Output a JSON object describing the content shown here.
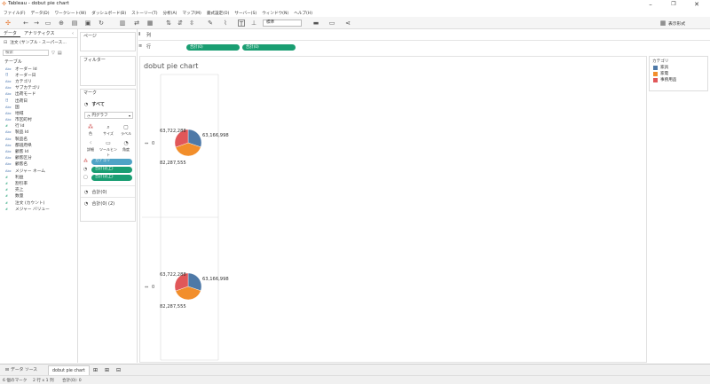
{
  "window": {
    "title": "Tableau - dobut pie chart"
  },
  "menu": [
    "ファイル(F)",
    "データ(D)",
    "ワークシート(W)",
    "ダッシュボード(B)",
    "ストーリー(T)",
    "分析(A)",
    "マップ(M)",
    "書式設定(O)",
    "サーバー(S)",
    "ウィンドウ(N)",
    "ヘルプ(H)"
  ],
  "toolbar": {
    "fit_select": "標準",
    "show_me": "表示形式"
  },
  "data_pane": {
    "tabs": [
      "データ",
      "アナリティクス"
    ],
    "source": "注文 (サンプル - スーパース...",
    "search_placeholder": "検索",
    "table_header": "テーブル",
    "fields": [
      {
        "type": "Abc",
        "name": "オーダー Id"
      },
      {
        "type": "日",
        "name": "オーダー日"
      },
      {
        "type": "Abc",
        "name": "カテゴリ"
      },
      {
        "type": "Abc",
        "name": "サブカテゴリ"
      },
      {
        "type": "Abc",
        "name": "出荷モード"
      },
      {
        "type": "日",
        "name": "出荷日"
      },
      {
        "type": "Abc",
        "name": "国"
      },
      {
        "type": "Abc",
        "name": "地域"
      },
      {
        "type": "Abc",
        "name": "市区町村"
      },
      {
        "type": "#",
        "name": "行 Id"
      },
      {
        "type": "Abc",
        "name": "製品 Id"
      },
      {
        "type": "Abc",
        "name": "製品名"
      },
      {
        "type": "Abc",
        "name": "都道府県"
      },
      {
        "type": "Abc",
        "name": "顧客 Id"
      },
      {
        "type": "Abc",
        "name": "顧客区分"
      },
      {
        "type": "Abc",
        "name": "顧客名"
      },
      {
        "type": "Abc",
        "name": "メジャー ネーム"
      },
      {
        "type": "#",
        "name": "利益"
      },
      {
        "type": "#",
        "name": "割引率"
      },
      {
        "type": "#",
        "name": "売上"
      },
      {
        "type": "#",
        "name": "数量"
      },
      {
        "type": "#",
        "name": "注文 (カウント)"
      },
      {
        "type": "#",
        "name": "メジャー バリュー"
      }
    ]
  },
  "shelves": {
    "pages": "ページ",
    "filters": "フィルター",
    "marks": "マーク",
    "marks_all": "すべて",
    "mark_type": "円グラフ",
    "buttons": [
      "色",
      "サイズ",
      "ラベル",
      "詳細",
      "ツールヒント",
      "角度"
    ],
    "mark_pills": [
      "カテゴリ",
      "合計(売上)",
      "合計(売上)"
    ],
    "sum1": "合計(0)",
    "sum2": "合計(0) (2)",
    "columns_label": "列",
    "rows_label": "行",
    "row_pills": [
      "合計(0)",
      "合計(0)"
    ]
  },
  "view": {
    "title": "dobut pie chart",
    "axis_zero": "0"
  },
  "chart_data": {
    "type": "pie",
    "title": "dobut pie chart",
    "categories": [
      "家具",
      "家電",
      "事務用品"
    ],
    "values": [
      63166998,
      82287555,
      63722288
    ],
    "labels": [
      "63,166,998",
      "82,287,555",
      "63,722,288"
    ],
    "colors": [
      "#4e79a7",
      "#f28e2b",
      "#e15759"
    ],
    "legend_title": "カテゴリ",
    "legend_position": "right",
    "panes": 2
  },
  "tabs": {
    "data_source": "データ ソース",
    "sheet": "dobut pie chart"
  },
  "status": {
    "marks": "6 個のマーク",
    "rows_cols": "2 行 x 1 列",
    "sum": "合計(0): 0"
  }
}
